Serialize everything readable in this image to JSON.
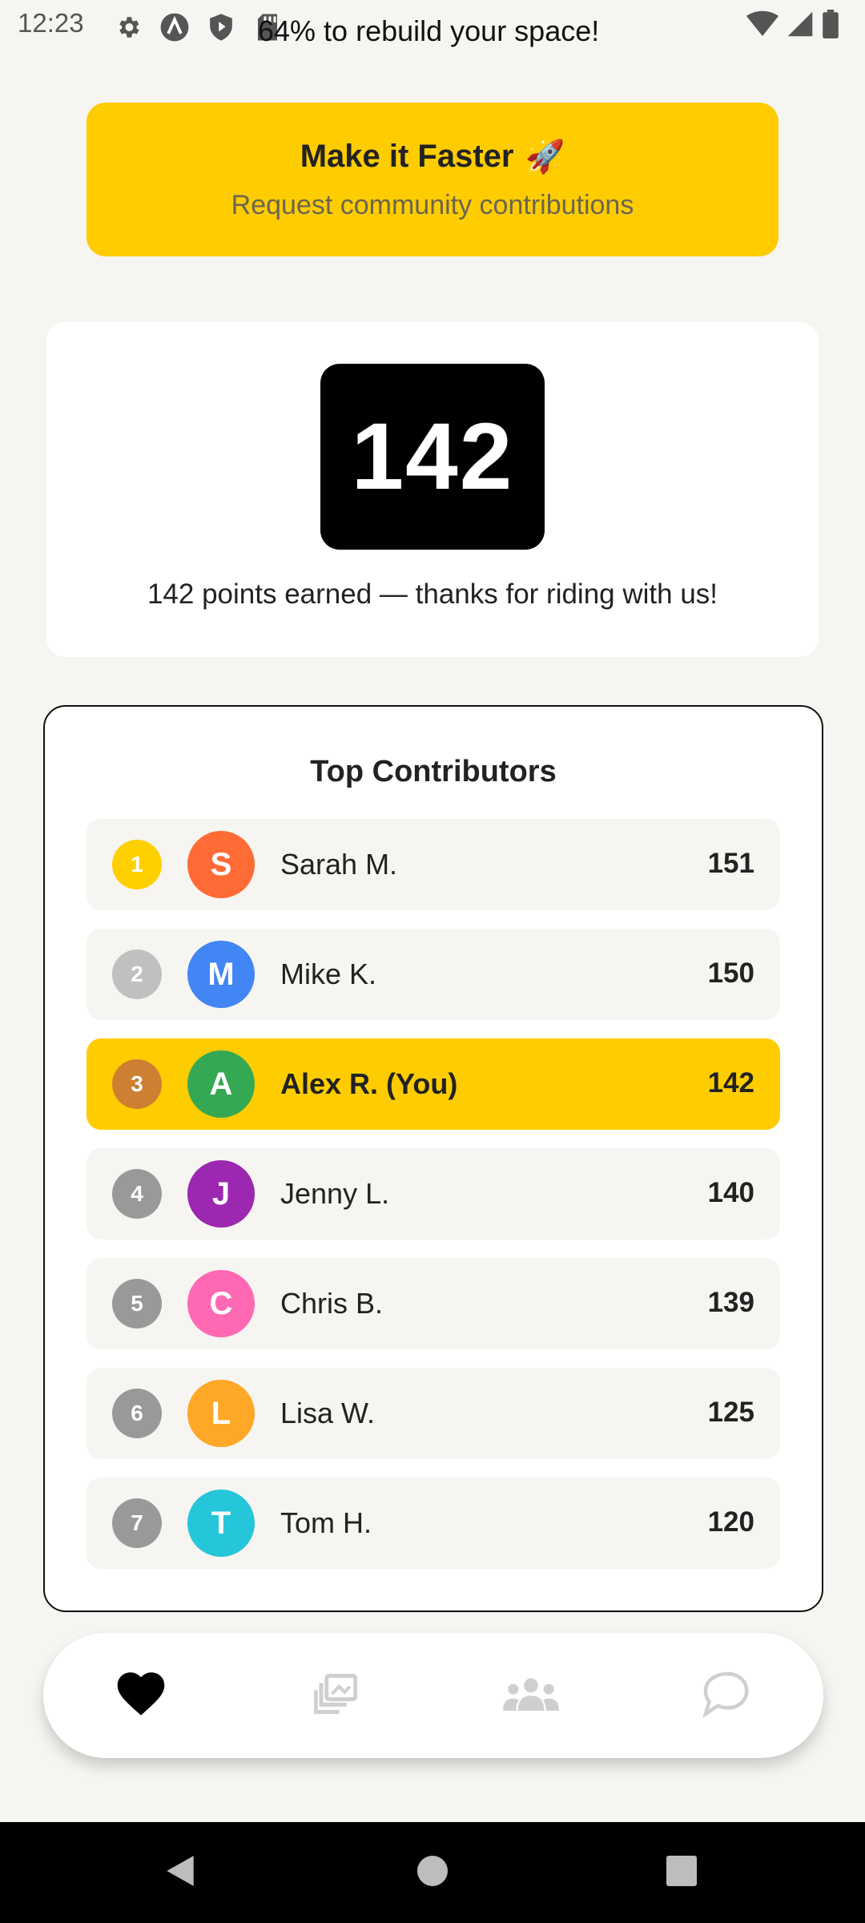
{
  "status_bar": {
    "time": "12:23",
    "banner_text": "64% to rebuild your space!",
    "left_icons": [
      "gear-icon",
      "a-logo-icon",
      "shield-play-icon",
      "sd-card-icon"
    ],
    "right_icons": [
      "wifi-icon",
      "signal-icon",
      "battery-icon"
    ]
  },
  "faster_button": {
    "title": "Make it Faster",
    "emoji": "🚀",
    "subtitle": "Request community contributions",
    "color": "#ffcc00"
  },
  "points_card": {
    "points": "142",
    "caption": "142 points earned — thanks for riding with us!"
  },
  "contributors": {
    "title": "Top Contributors",
    "rows": [
      {
        "rank": "1",
        "initial": "S",
        "name": "Sarah M.",
        "points": "151",
        "rank_color": "#ffd000",
        "avatar_color": "#ff6b35"
      },
      {
        "rank": "2",
        "initial": "M",
        "name": "Mike K.",
        "points": "150",
        "rank_color": "#c0c0c0",
        "avatar_color": "#4285f4"
      },
      {
        "rank": "3",
        "initial": "A",
        "name": "Alex R. (You)",
        "points": "142",
        "rank_color": "#cd7f32",
        "avatar_color": "#34a853",
        "highlight": true
      },
      {
        "rank": "4",
        "initial": "J",
        "name": "Jenny L.",
        "points": "140",
        "rank_color": "#999999",
        "avatar_color": "#9c27b0"
      },
      {
        "rank": "5",
        "initial": "C",
        "name": "Chris B.",
        "points": "139",
        "rank_color": "#999999",
        "avatar_color": "#ff69b4"
      },
      {
        "rank": "6",
        "initial": "L",
        "name": "Lisa W.",
        "points": "125",
        "rank_color": "#999999",
        "avatar_color": "#ffa726"
      },
      {
        "rank": "7",
        "initial": "T",
        "name": "Tom H.",
        "points": "120",
        "rank_color": "#999999",
        "avatar_color": "#26c6da"
      }
    ]
  },
  "tab_bar": {
    "tabs": [
      {
        "icon": "heart-icon",
        "active": true
      },
      {
        "icon": "gallery-icon",
        "active": false
      },
      {
        "icon": "group-icon",
        "active": false
      },
      {
        "icon": "chat-icon",
        "active": false
      }
    ]
  },
  "nav_bar": {
    "buttons": [
      "back-icon",
      "home-icon",
      "recents-icon"
    ]
  }
}
